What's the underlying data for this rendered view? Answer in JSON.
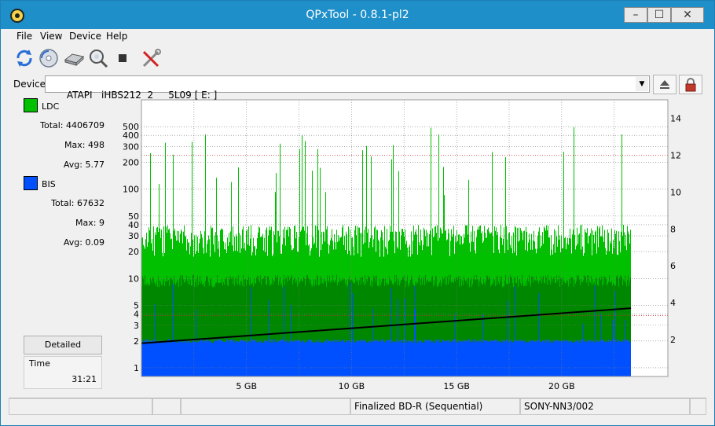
{
  "window": {
    "title": "QPxTool - 0.8.1-pl2"
  },
  "menu": [
    "File",
    "View",
    "Device",
    "Help"
  ],
  "toolbar": [
    "refresh-icon",
    "disc-scan-icon",
    "drive-icon",
    "media-search-icon",
    "stop-icon",
    "tools-icon"
  ],
  "device": {
    "label": "Device:",
    "value": "ATAPI   iHBS212  2     5L09 [ E: ]"
  },
  "stats": {
    "ldc": {
      "label": "LDC",
      "color": "#00c000",
      "total": "Total: 4406709",
      "max": "Max: 498",
      "avg": "Avg: 5.77"
    },
    "bis": {
      "label": "BIS",
      "color": "#0050ff",
      "total": "Total: 67632",
      "max": "Max: 9",
      "avg": "Avg: 0.09"
    },
    "detailed_button": "Detailed",
    "time_label": "Time",
    "time_value": "31:21"
  },
  "status": {
    "cells": [
      "",
      "",
      "",
      "Finalized BD-R (Sequential)",
      "SONY-NN3/002",
      ""
    ]
  },
  "chart_data": {
    "type": "area",
    "x_unit": "GB",
    "x_ticks": [
      "5 GB",
      "10 GB",
      "15 GB",
      "20 GB"
    ],
    "x_tick_values": [
      5,
      10,
      15,
      20
    ],
    "x_range": [
      0,
      23.3
    ],
    "y_left_scale": "log",
    "y_left_ticks": [
      "1",
      "2",
      "3",
      "4",
      "5",
      "10",
      "20",
      "30",
      "40",
      "50",
      "100",
      "200",
      "300",
      "400",
      "500"
    ],
    "y_left_tick_values": [
      1,
      2,
      3,
      4,
      5,
      10,
      20,
      30,
      40,
      50,
      100,
      200,
      300,
      400,
      500
    ],
    "y_right_ticks": [
      "2",
      "4",
      "6",
      "8",
      "10",
      "12",
      "14"
    ],
    "y_right_tick_values": [
      2,
      4,
      6,
      8,
      10,
      12,
      14
    ],
    "grid": true,
    "series": [
      {
        "name": "LDC",
        "color": "#00c000",
        "typical": 25,
        "peak": 498,
        "average": 5.77
      },
      {
        "name": "BIS",
        "color": "#0050ff",
        "typical": 2,
        "peak": 9,
        "average": 0.09
      },
      {
        "color": "#000000",
        "x": [
          0,
          23.3
        ],
        "y": [
          1.8,
          3.7
        ]
      }
    ]
  }
}
